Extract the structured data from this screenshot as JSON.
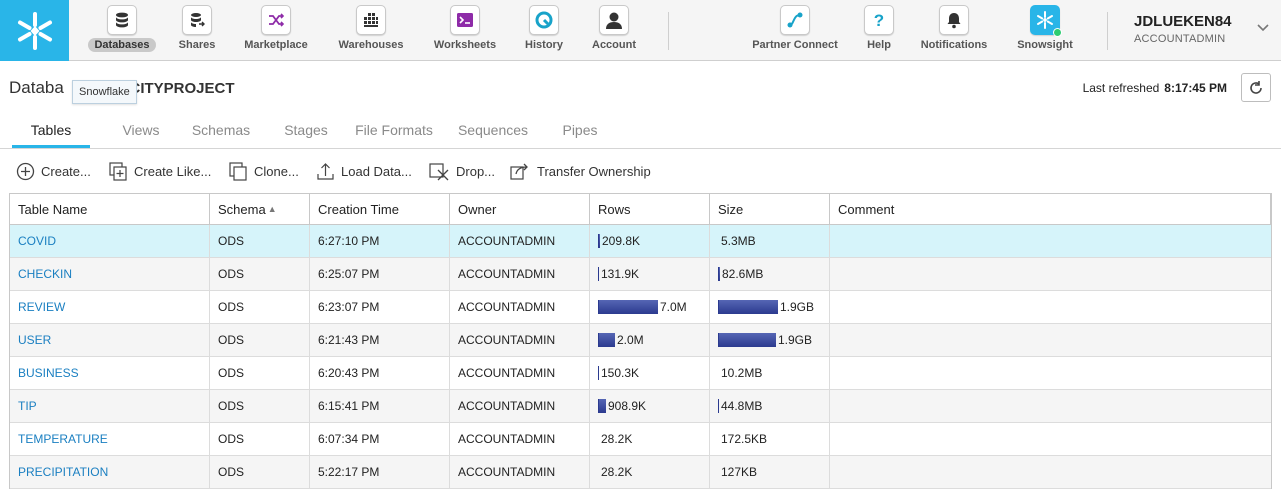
{
  "nav": {
    "items": [
      {
        "label": "Databases",
        "icon": "database-icon"
      },
      {
        "label": "Shares",
        "icon": "shares-icon"
      },
      {
        "label": "Marketplace",
        "icon": "marketplace-icon"
      },
      {
        "label": "Warehouses",
        "icon": "warehouses-icon"
      },
      {
        "label": "Worksheets",
        "icon": "worksheet-icon"
      },
      {
        "label": "History",
        "icon": "history-icon"
      },
      {
        "label": "Account",
        "icon": "account-icon"
      },
      {
        "label": "Partner Connect",
        "icon": "partner-connect-icon"
      },
      {
        "label": "Help",
        "icon": "help-icon"
      },
      {
        "label": "Notifications",
        "icon": "bell-icon"
      },
      {
        "label": "Snowsight",
        "icon": "snowsight-icon"
      }
    ],
    "active": "Databases"
  },
  "user": {
    "name": "JDLUEKEN84",
    "role": "ACCOUNTADMIN"
  },
  "page": {
    "title_prefix": "Databa",
    "title_db": "DACITYPROJECT",
    "tooltip": "Snowflake",
    "last_refreshed_label": "Last refreshed",
    "last_refreshed_time": "8:17:45 PM"
  },
  "tabs": [
    "Tables",
    "Views",
    "Schemas",
    "Stages",
    "File Formats",
    "Sequences",
    "Pipes"
  ],
  "toolbar": {
    "create": "Create...",
    "create_like": "Create Like...",
    "clone": "Clone...",
    "load_data": "Load Data...",
    "drop": "Drop...",
    "transfer": "Transfer Ownership"
  },
  "table": {
    "columns": [
      "Table Name",
      "Schema",
      "Creation Time",
      "Owner",
      "Rows",
      "Size",
      "Comment"
    ],
    "rows": [
      {
        "name": "COVID",
        "schema": "ODS",
        "time": "6:27:10 PM",
        "owner": "ACCOUNTADMIN",
        "rows": "209.8K",
        "rows_fraction": 0.03,
        "size": "5.3MB",
        "size_fraction": 0.0,
        "selected": true
      },
      {
        "name": "CHECKIN",
        "schema": "ODS",
        "time": "6:25:07 PM",
        "owner": "ACCOUNTADMIN",
        "rows": "131.9K",
        "rows_fraction": 0.02,
        "size": "82.6MB",
        "size_fraction": 0.04
      },
      {
        "name": "REVIEW",
        "schema": "ODS",
        "time": "6:23:07 PM",
        "owner": "ACCOUNTADMIN",
        "rows": "7.0M",
        "rows_fraction": 1.0,
        "size": "1.9GB",
        "size_fraction": 1.0
      },
      {
        "name": "USER",
        "schema": "ODS",
        "time": "6:21:43 PM",
        "owner": "ACCOUNTADMIN",
        "rows": "2.0M",
        "rows_fraction": 0.29,
        "size": "1.9GB",
        "size_fraction": 0.97
      },
      {
        "name": "BUSINESS",
        "schema": "ODS",
        "time": "6:20:43 PM",
        "owner": "ACCOUNTADMIN",
        "rows": "150.3K",
        "rows_fraction": 0.02,
        "size": "10.2MB",
        "size_fraction": 0.0
      },
      {
        "name": "TIP",
        "schema": "ODS",
        "time": "6:15:41 PM",
        "owner": "ACCOUNTADMIN",
        "rows": "908.9K",
        "rows_fraction": 0.13,
        "size": "44.8MB",
        "size_fraction": 0.02
      },
      {
        "name": "TEMPERATURE",
        "schema": "ODS",
        "time": "6:07:34 PM",
        "owner": "ACCOUNTADMIN",
        "rows": "28.2K",
        "rows_fraction": 0.0,
        "size": "172.5KB",
        "size_fraction": 0.0
      },
      {
        "name": "PRECIPITATION",
        "schema": "ODS",
        "time": "5:22:17 PM",
        "owner": "ACCOUNTADMIN",
        "rows": "28.2K",
        "rows_fraction": 0.0,
        "size": "127KB",
        "size_fraction": 0.0
      }
    ]
  },
  "colors": {
    "brand": "#29b5e8",
    "link": "#1a7fc1",
    "bar": "#2b3a8f",
    "selected_row": "#d6f4fa"
  }
}
